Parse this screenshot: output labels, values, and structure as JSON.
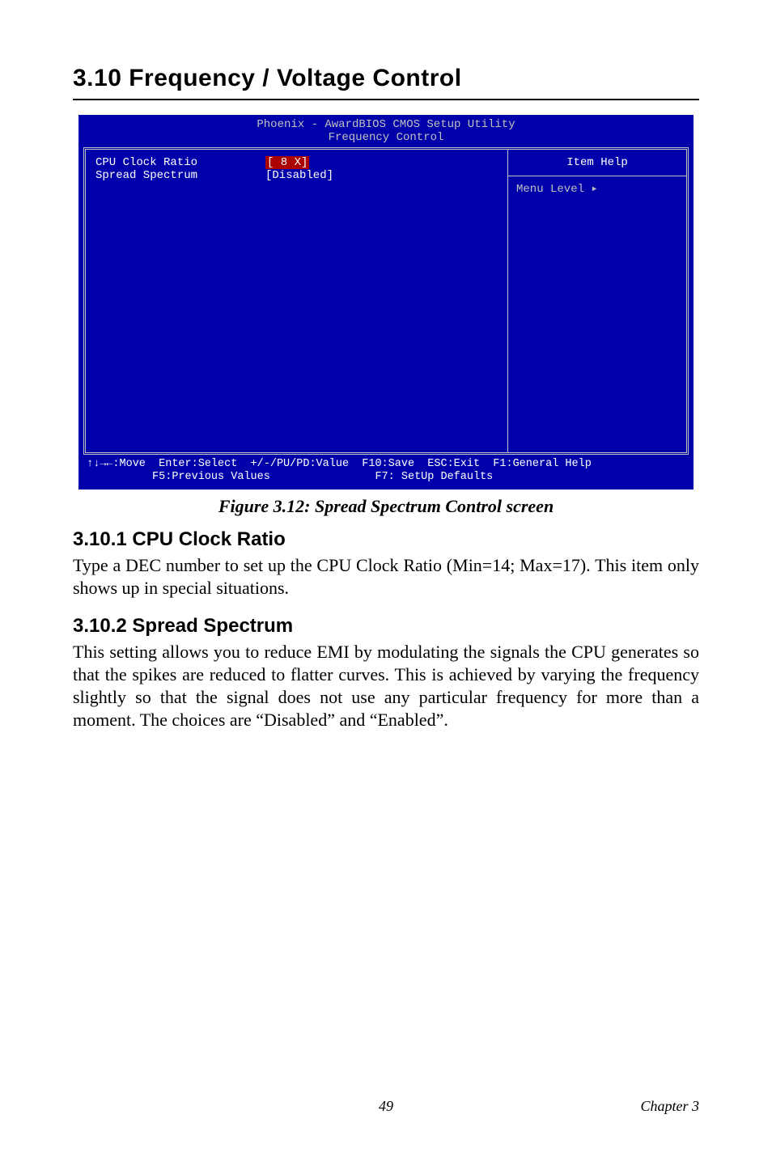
{
  "section": {
    "number": "3.10",
    "title": "Frequency / Voltage Control",
    "heading": "3.10  Frequency / Voltage Control"
  },
  "bios": {
    "title_line1": "Phoenix - AwardBIOS CMOS Setup Utility",
    "title_line2": "Frequency Control",
    "rows": [
      {
        "label": "CPU Clock Ratio",
        "value": "[ 8 X]",
        "selected": true
      },
      {
        "label": "Spread Spectrum",
        "value": "[Disabled]",
        "selected": false
      }
    ],
    "help_title": "Item Help",
    "help_body": "Menu Level   ▸",
    "footer_line1": "↑↓→←:Move  Enter:Select  +/-/PU/PD:Value  F10:Save  ESC:Exit  F1:General Help",
    "footer_line2": "          F5:Previous Values                F7: SetUp Defaults"
  },
  "figure_caption": "Figure 3.12: Spread Spectrum Control screen",
  "subsections": [
    {
      "heading": "3.10.1 CPU Clock Ratio",
      "body": "Type a DEC number to set up the CPU Clock Ratio (Min=14; Max=17). This item only shows up in special situations."
    },
    {
      "heading": "3.10.2 Spread Spectrum",
      "body": "This setting allows you to reduce EMI by modulating the signals the CPU generates so that the spikes are reduced to flatter curves. This is achieved by varying the frequency slightly so that the signal does not use any particular frequency for more than a moment. The choices are “Disabled” and “Enabled”."
    }
  ],
  "footer": {
    "page": "49",
    "chapter": "Chapter 3"
  }
}
